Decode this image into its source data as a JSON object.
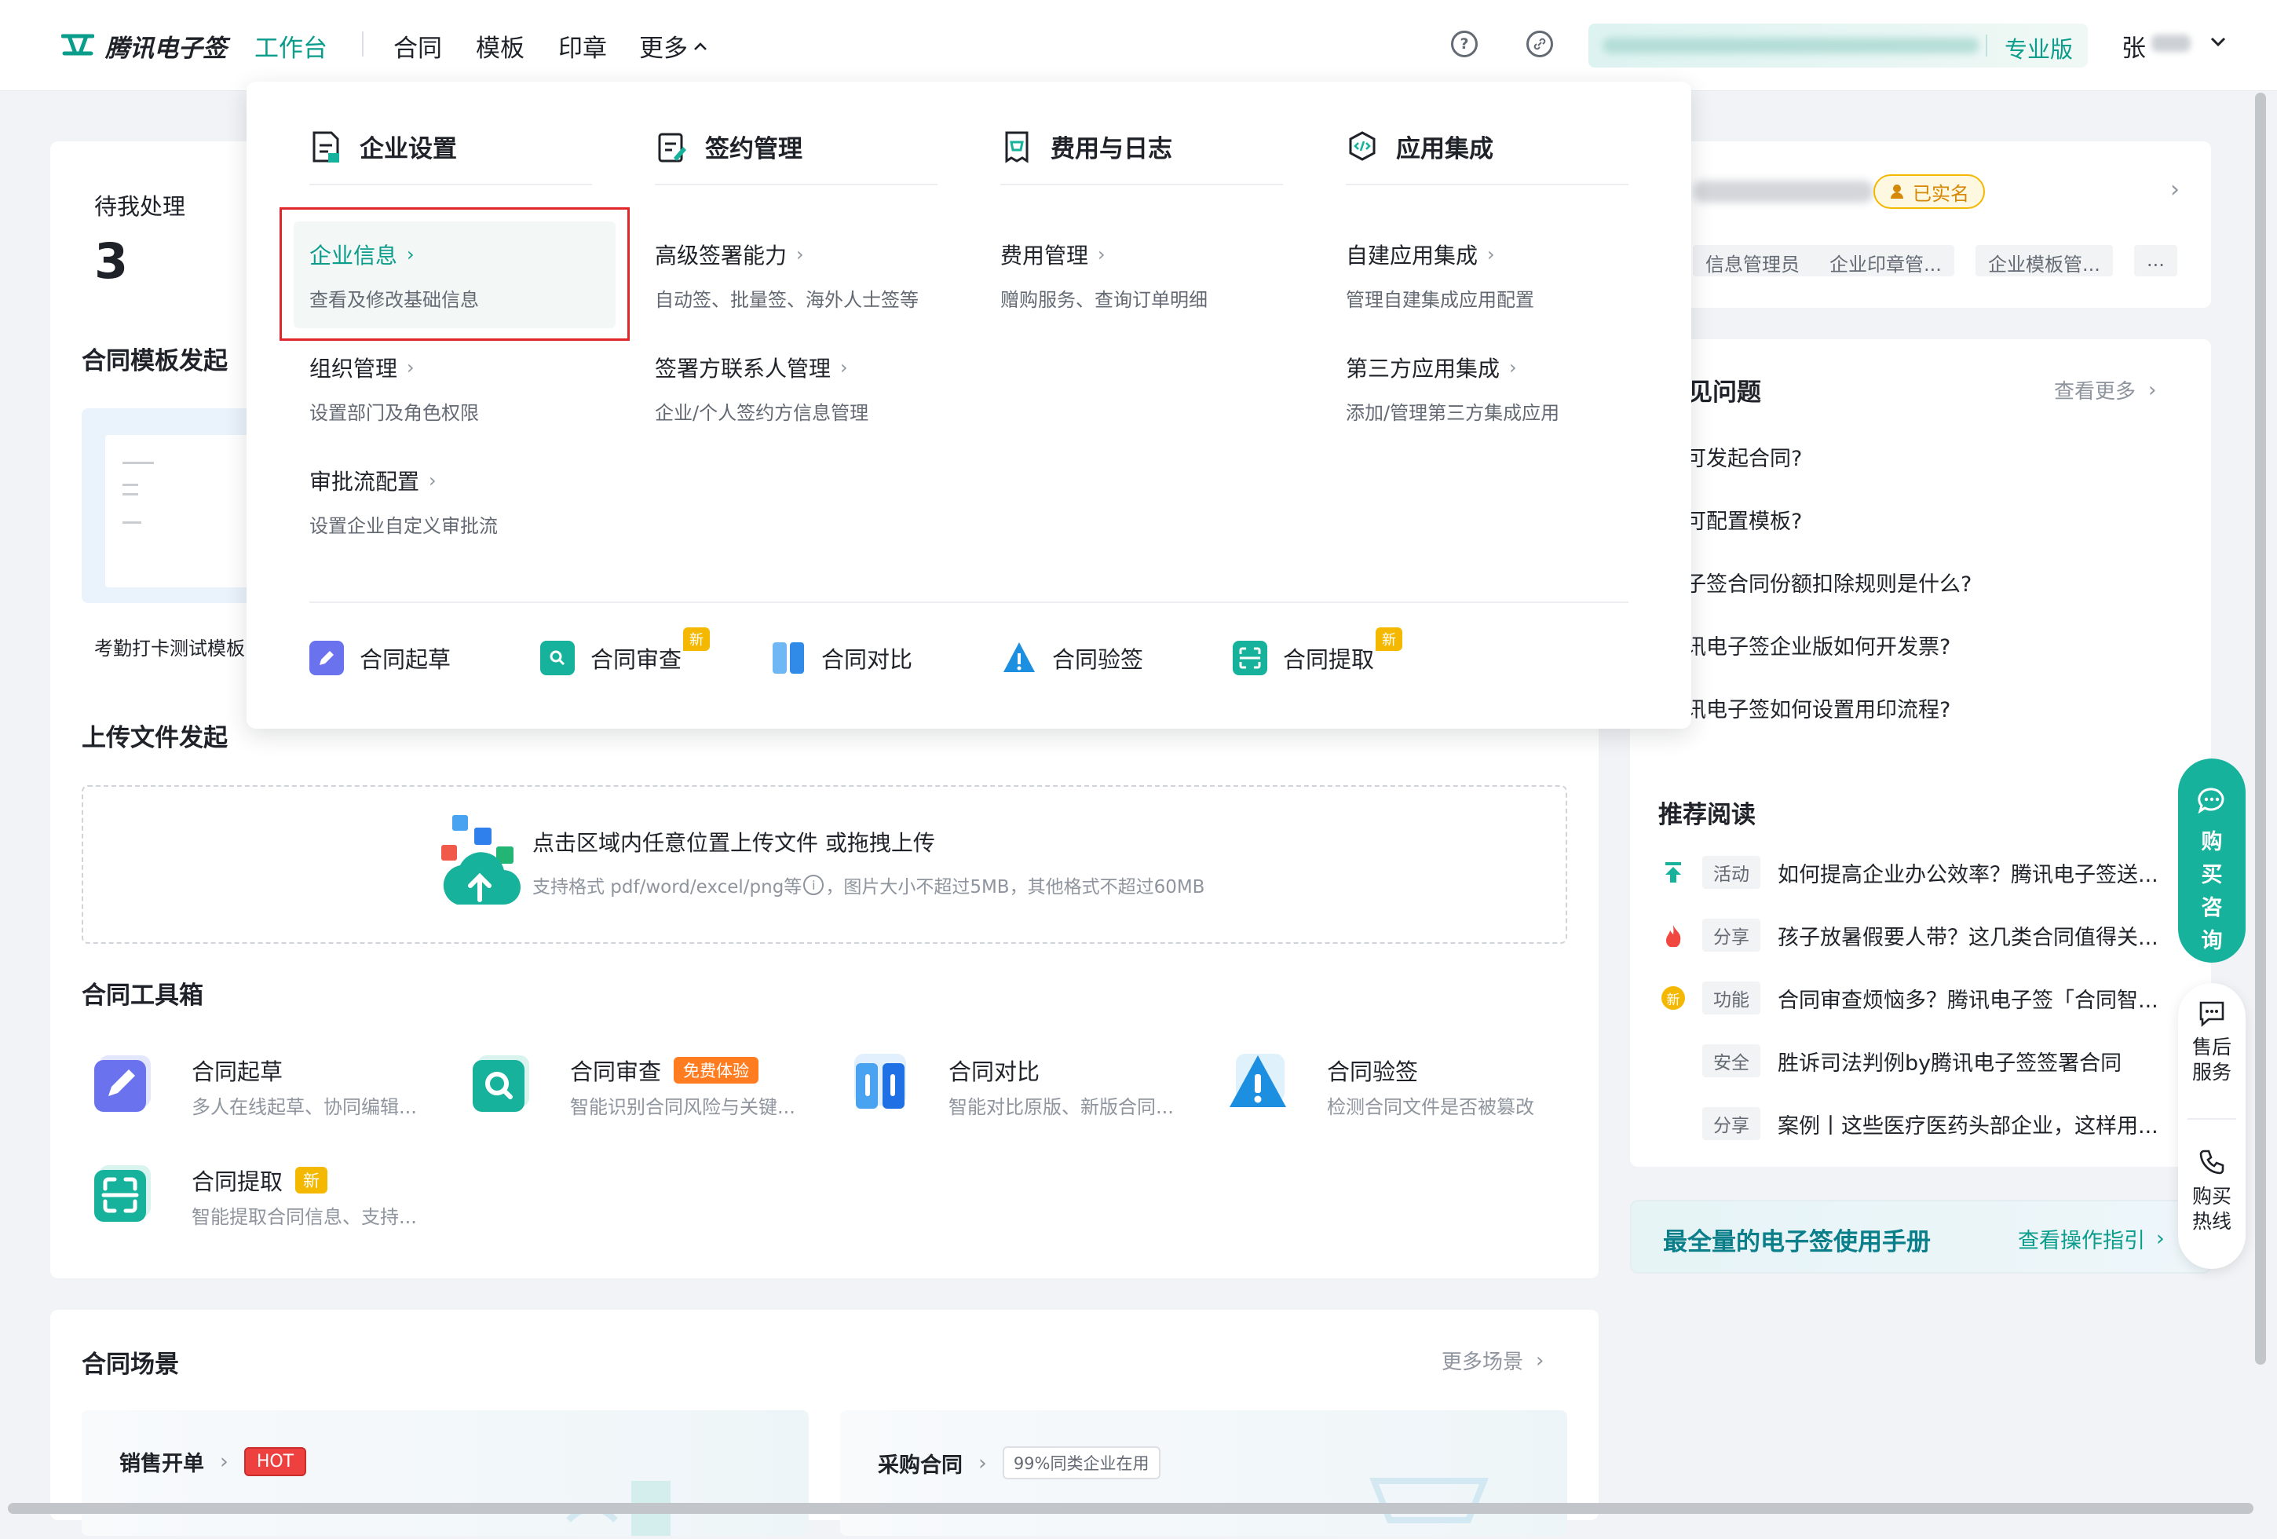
{
  "nav": {
    "brand": "腾讯电子签",
    "items": [
      "工作台",
      "合同",
      "模板",
      "印章",
      "更多"
    ],
    "edition": "专业版",
    "user_initial": "张"
  },
  "pending": {
    "title": "待我处理",
    "count": "3"
  },
  "template_section": {
    "title": "合同模板发起",
    "template_name": "考勤打卡测试模板"
  },
  "upload": {
    "title": "上传文件发起",
    "main_text": "点击区域内任意位置上传文件 或拖拽上传",
    "sub_text": "支持格式 pdf/word/excel/png等",
    "sub_text_2": "，图片大小不超过5MB，其他格式不超过60MB"
  },
  "toolbox": {
    "title": "合同工具箱",
    "tools": [
      {
        "name": "合同起草",
        "desc": "多人在线起草、协同编辑..."
      },
      {
        "name": "合同审查",
        "badge": "免费体验",
        "desc": "智能识别合同风险与关键..."
      },
      {
        "name": "合同对比",
        "desc": "智能对比原版、新版合同..."
      },
      {
        "name": "合同验签",
        "desc": "检测合同文件是否被篡改"
      },
      {
        "name": "合同提取",
        "badge": "新",
        "desc": "智能提取合同信息、支持..."
      }
    ]
  },
  "scenes": {
    "title": "合同场景",
    "more": "更多场景",
    "items": [
      {
        "name": "销售开单",
        "badge": "HOT"
      },
      {
        "name": "采购合同",
        "badge": "99%同类企业在用"
      }
    ]
  },
  "profile": {
    "verified": "已实名",
    "roles": [
      "信息管理员",
      "企业印章管...",
      "企业模板管...",
      "..."
    ]
  },
  "faq": {
    "title": "见问题",
    "more": "查看更多",
    "items": [
      "可发起合同?",
      "可配置模板?",
      "子签合同份额扣除规则是什么?",
      "讯电子签企业版如何开发票?",
      "讯电子签如何设置用印流程?"
    ]
  },
  "reading": {
    "title": "推荐阅读",
    "items": [
      {
        "tag": "活动",
        "text": "如何提高企业办公效率？腾讯电子签送..."
      },
      {
        "tag": "分享",
        "text": "孩子放暑假要人带？这几类合同值得关..."
      },
      {
        "tag": "功能",
        "text": "合同审查烦恼多？腾讯电子签「合同智..."
      },
      {
        "tag": "安全",
        "text": "胜诉司法判例by腾讯电子签签署合同"
      },
      {
        "tag": "分享",
        "text": "案例丨这些医疗医药头部企业，这样用..."
      }
    ]
  },
  "manual": {
    "title": "最全量的电子签使用手册",
    "link": "查看操作指引"
  },
  "float": {
    "consult": [
      "购",
      "买",
      "咨",
      "询"
    ],
    "after_sales": "售后\n服务",
    "hotline": "购买\n热线"
  },
  "menu": {
    "columns": [
      {
        "title": "企业设置",
        "entries": [
          {
            "title": "企业信息",
            "desc": "查看及修改基础信息"
          },
          {
            "title": "组织管理",
            "desc": "设置部门及角色权限"
          },
          {
            "title": "审批流配置",
            "desc": "设置企业自定义审批流"
          }
        ]
      },
      {
        "title": "签约管理",
        "entries": [
          {
            "title": "高级签署能力",
            "desc": "自动签、批量签、海外人士签等"
          },
          {
            "title": "签署方联系人管理",
            "desc": "企业/个人签约方信息管理"
          }
        ]
      },
      {
        "title": "费用与日志",
        "entries": [
          {
            "title": "费用管理",
            "desc": "赠购服务、查询订单明细"
          }
        ]
      },
      {
        "title": "应用集成",
        "entries": [
          {
            "title": "自建应用集成",
            "desc": "管理自建集成应用配置"
          },
          {
            "title": "第三方应用集成",
            "desc": "添加/管理第三方集成应用"
          }
        ]
      }
    ],
    "quick_tools": [
      {
        "name": "合同起草"
      },
      {
        "name": "合同审查",
        "badge": "新"
      },
      {
        "name": "合同对比"
      },
      {
        "name": "合同验签"
      },
      {
        "name": "合同提取",
        "badge": "新"
      }
    ]
  },
  "colors": {
    "accent": "#0a9d8b",
    "highlight_border": "#e0252b",
    "badge_orange": "#ff7d20",
    "badge_yellow": "#f5b800",
    "hot": "#ef4040"
  }
}
